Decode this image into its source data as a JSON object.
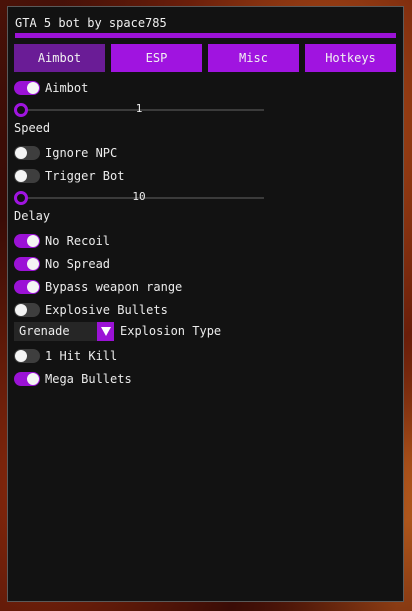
{
  "window": {
    "title": "GTA 5 bot by space785"
  },
  "tabs": [
    {
      "label": "Aimbot",
      "active": true
    },
    {
      "label": "ESP",
      "active": false
    },
    {
      "label": "Misc",
      "active": false
    },
    {
      "label": "Hotkeys",
      "active": false
    }
  ],
  "aimbot": {
    "aimbot_toggle": {
      "label": "Aimbot",
      "on": true
    },
    "speed_slider": {
      "value": "1",
      "label": "Speed"
    },
    "ignore_npc": {
      "label": "Ignore NPC",
      "on": false
    },
    "trigger_bot": {
      "label": "Trigger Bot",
      "on": false
    },
    "delay_slider": {
      "value": "10",
      "label": "Delay"
    },
    "no_recoil": {
      "label": "No Recoil",
      "on": true
    },
    "no_spread": {
      "label": "No Spread",
      "on": true
    },
    "bypass_range": {
      "label": "Bypass weapon range",
      "on": true
    },
    "explosive_bullets": {
      "label": "Explosive Bullets",
      "on": false
    },
    "explosion_type": {
      "selected": "Grenade",
      "label": "Explosion Type"
    },
    "one_hit_kill": {
      "label": "1 Hit Kill",
      "on": false
    },
    "mega_bullets": {
      "label": "Mega Bullets",
      "on": true
    }
  },
  "colors": {
    "accent": "#9b12d6",
    "active_tab": "#6a1c96",
    "window_bg": "#121212"
  },
  "icons": {
    "combo_arrow": "triangle-down-icon"
  }
}
